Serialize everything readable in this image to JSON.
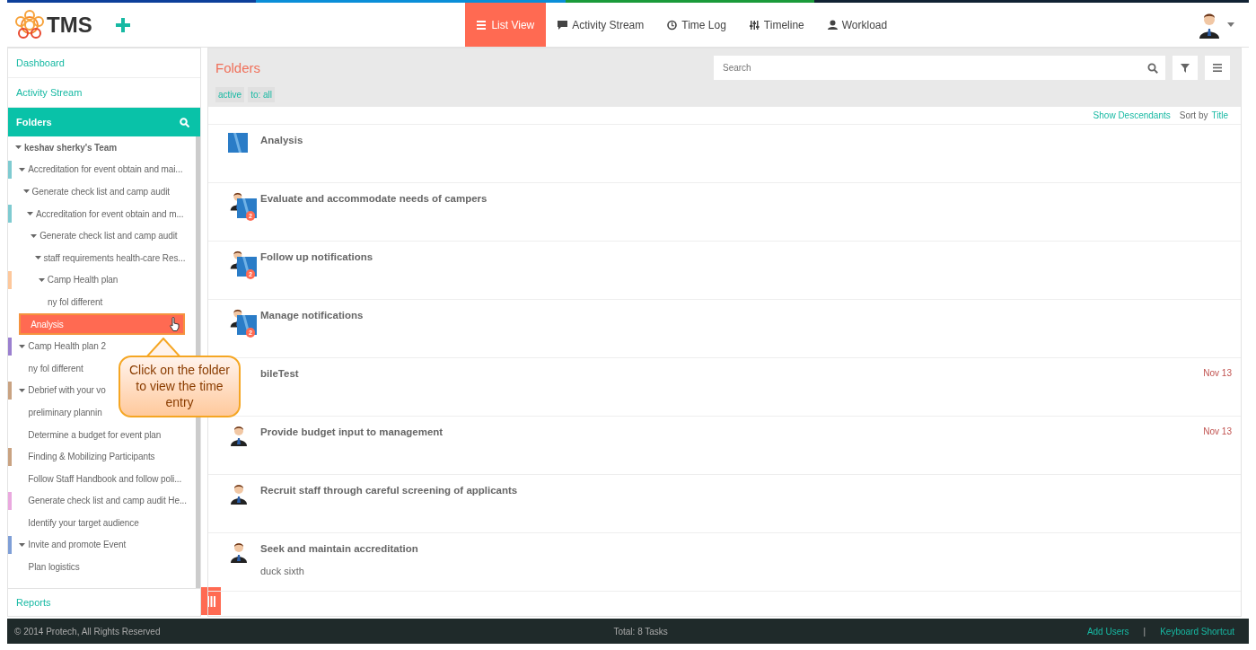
{
  "header": {
    "logo_text": "TMS",
    "nav": [
      {
        "label": "List View",
        "kind": "list",
        "selected": true
      },
      {
        "label": "Activity Stream",
        "kind": "comment",
        "selected": false
      },
      {
        "label": "Time Log",
        "kind": "clock",
        "selected": false
      },
      {
        "label": "Timeline",
        "kind": "sliders",
        "selected": false
      },
      {
        "label": "Workload",
        "kind": "user",
        "selected": false
      }
    ]
  },
  "sidebar": {
    "links": [
      "Dashboard",
      "Activity Stream"
    ],
    "folders_title": "Folders",
    "tree": [
      {
        "label": "keshav sherky's Team",
        "expanded": true,
        "selected": false,
        "children": [
          {
            "label": "Accreditation for event obtain and mai...",
            "expanded": true,
            "color": "#7fcbd1",
            "selected": false,
            "children": [
              {
                "label": "Generate check list and camp audit",
                "expanded": true,
                "selected": false,
                "children": [
                  {
                    "label": "Accreditation for event obtain and m...",
                    "expanded": true,
                    "color": "#7fcbd1",
                    "selected": false,
                    "children": [
                      {
                        "label": "Generate check list and camp audit",
                        "expanded": true,
                        "selected": false,
                        "children": [
                          {
                            "label": "staff requirements health-care Res...",
                            "expanded": true,
                            "selected": false,
                            "children": [
                              {
                                "label": "Camp Health plan",
                                "expanded": true,
                                "color": "#fdc89c",
                                "selected": false,
                                "children": [
                                  {
                                    "label": "ny fol different",
                                    "selected": false
                                  }
                                ]
                              }
                            ]
                          }
                        ]
                      }
                    ]
                  }
                ]
              }
            ]
          },
          {
            "label": "Analysis",
            "selected": true
          },
          {
            "label": "Camp Health plan 2",
            "expanded": true,
            "color": "#9b80cf",
            "selected": false,
            "children": [
              {
                "label": "ny fol different",
                "selected": false
              }
            ]
          },
          {
            "label": "Debrief with your vo",
            "expanded": true,
            "color": "#c9a382",
            "selected": false,
            "children": [
              {
                "label": "preliminary plannin",
                "selected": false
              }
            ]
          },
          {
            "label": "Determine a budget for event plan",
            "selected": false
          },
          {
            "label": "Finding & Mobilizing Participants",
            "color": "#c9a382",
            "selected": false
          },
          {
            "label": "Follow Staff Handbook and follow poli...",
            "selected": false
          },
          {
            "label": "Generate check list and camp audit He...",
            "color": "#eaa9df",
            "selected": false
          },
          {
            "label": "Identify your target audience",
            "selected": false
          },
          {
            "label": "Invite and promote Event",
            "expanded": true,
            "color": "#7f9fd7",
            "selected": false,
            "children": [
              {
                "label": "Plan logistics",
                "selected": false
              }
            ]
          }
        ]
      }
    ],
    "footer_link": "Reports"
  },
  "main": {
    "title": "Folders",
    "search": {
      "placeholder": "Search"
    },
    "tags": [
      "active",
      "to: all"
    ],
    "show_descendants": "Show Descendants",
    "sort_label": "Sort by",
    "sort_value": "Title",
    "tasks": [
      {
        "title": "Analysis",
        "kind": "folder"
      },
      {
        "title": "Evaluate and accommodate needs of campers",
        "kind": "shared",
        "badge": "2"
      },
      {
        "title": "Follow up notifications",
        "kind": "shared",
        "badge": "2"
      },
      {
        "title": "Manage notifications",
        "kind": "shared",
        "badge": "2"
      },
      {
        "title": "bileTest",
        "kind": "hidden",
        "date": "Nov 13"
      },
      {
        "title": "Provide budget input to management",
        "kind": "user",
        "date": "Nov 13"
      },
      {
        "title": "Recruit staff through careful screening of applicants",
        "kind": "user"
      },
      {
        "title": "Seek and maintain accreditation",
        "kind": "user",
        "subtitle": "duck sixth"
      }
    ]
  },
  "callout": {
    "text": "Click on the folder to view the time entry"
  },
  "footer": {
    "copyright": "© 2014 Protech, All Rights Reserved",
    "total": "Total: 8 Tasks",
    "links": [
      "Add Users",
      "Keyboard Shortcut"
    ],
    "separator": "|"
  }
}
